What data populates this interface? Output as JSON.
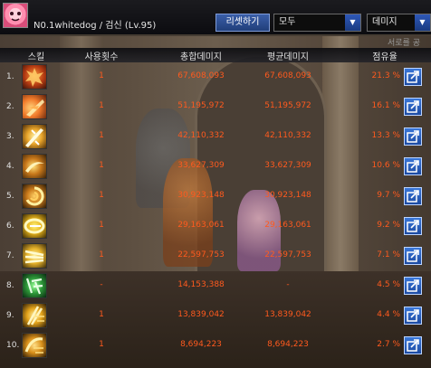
{
  "character": {
    "name_line": "N0.1whitedog  /  검신  (Lv.95)"
  },
  "toolbar": {
    "reset_label": "리셋하기",
    "category_value": "모두",
    "metric_value": "데미지",
    "dropdown_arrow": "▼"
  },
  "overlay_subtitle": "서로를 공",
  "headers": {
    "skill": "스킬",
    "uses": "사용횟수",
    "total": "총합데미지",
    "avg": "평균데미지",
    "share": "점유율"
  },
  "rows": [
    {
      "rank": "1.",
      "uses": "1",
      "total": "67,608,093",
      "avg": "67,608,093",
      "share": "21.3  %",
      "icon": "fire-burst-skill-icon"
    },
    {
      "rank": "2.",
      "uses": "1",
      "total": "51,195,972",
      "avg": "51,195,972",
      "share": "16.1  %",
      "icon": "flame-slash-skill-icon"
    },
    {
      "rank": "3.",
      "uses": "1",
      "total": "42,110,332",
      "avg": "42,110,332",
      "share": "13.3  %",
      "icon": "light-blade-skill-icon"
    },
    {
      "rank": "4.",
      "uses": "1",
      "total": "33,627,309",
      "avg": "33,627,309",
      "share": "10.6  %",
      "icon": "crescent-slash-skill-icon"
    },
    {
      "rank": "5.",
      "uses": "1",
      "total": "30,923,148",
      "avg": "30,923,148",
      "share": "9.7  %",
      "icon": "spiral-slash-skill-icon"
    },
    {
      "rank": "6.",
      "uses": "1",
      "total": "29,163,061",
      "avg": "29,163,061",
      "share": "9.2  %",
      "icon": "golden-arc-skill-icon"
    },
    {
      "rank": "7.",
      "uses": "1",
      "total": "22,597,753",
      "avg": "22,597,753",
      "share": "7.1  %",
      "icon": "triple-slash-skill-icon"
    },
    {
      "rank": "8.",
      "uses": "-",
      "total": "14,153,388",
      "avg": "-",
      "share": "4.5  %",
      "icon": "green-rune-skill-icon"
    },
    {
      "rank": "9.",
      "uses": "1",
      "total": "13,839,042",
      "avg": "13,839,042",
      "share": "4.4  %",
      "icon": "flow-strike-skill-icon"
    },
    {
      "rank": "10.",
      "uses": "1",
      "total": "8,694,223",
      "avg": "8,694,223",
      "share": "2.7  %",
      "icon": "flow-wave-skill-icon"
    }
  ],
  "colors": {
    "value_text": "#ff5a1e",
    "header_text": "#e0e0e0",
    "button_blue": "#2a5fc0"
  }
}
